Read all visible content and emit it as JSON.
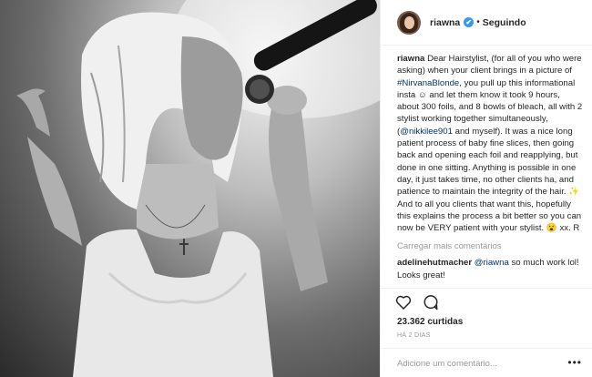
{
  "header": {
    "username": "riawna",
    "verified_mark": "✔",
    "separator": "•",
    "follow_label": "Seguindo"
  },
  "caption": {
    "username": "riawna",
    "text_1": "Dear Hairstylist, (for all of you who were asking) when your client brings in a picture of ",
    "hashtag": "#NirvanaBlonde",
    "text_2": ", you pull up this informational insta ☺ and let them know it took 9 hours, about 300 foils, and 8 bowls of bleach, all with 2 stylist working together simultaneously, (",
    "mention": "@nikkilee901",
    "text_3": " and myself). It was a nice long patient process of baby fine slices, then going back and opening each foil and reapplying, but done in one sitting. Anything is possible in one day, it just takes time, no other clients ha, and patience to maintain the integrity of the hair. ✨ And to all you clients that want this, hopefully this explains the process a bit better so you can now be VERY patient with your stylist. 😮 xx. R"
  },
  "load_more": "Carregar mais comentários",
  "comment": {
    "username": "adelinehutmacher",
    "mention": "@riawna",
    "text": " so much work lol! Looks great!"
  },
  "likes": "23.362 curtidas",
  "time": "HÁ 2 DIAS",
  "add_comment": {
    "placeholder": "Adicione um comentário..."
  },
  "more_options": "•••",
  "icons": {
    "like": "heart-icon",
    "comment": "comment-icon",
    "verified": "verified-badge-icon"
  },
  "colors": {
    "link": "#003569",
    "verified": "#3897f0",
    "muted": "#999999",
    "text": "#262626"
  }
}
